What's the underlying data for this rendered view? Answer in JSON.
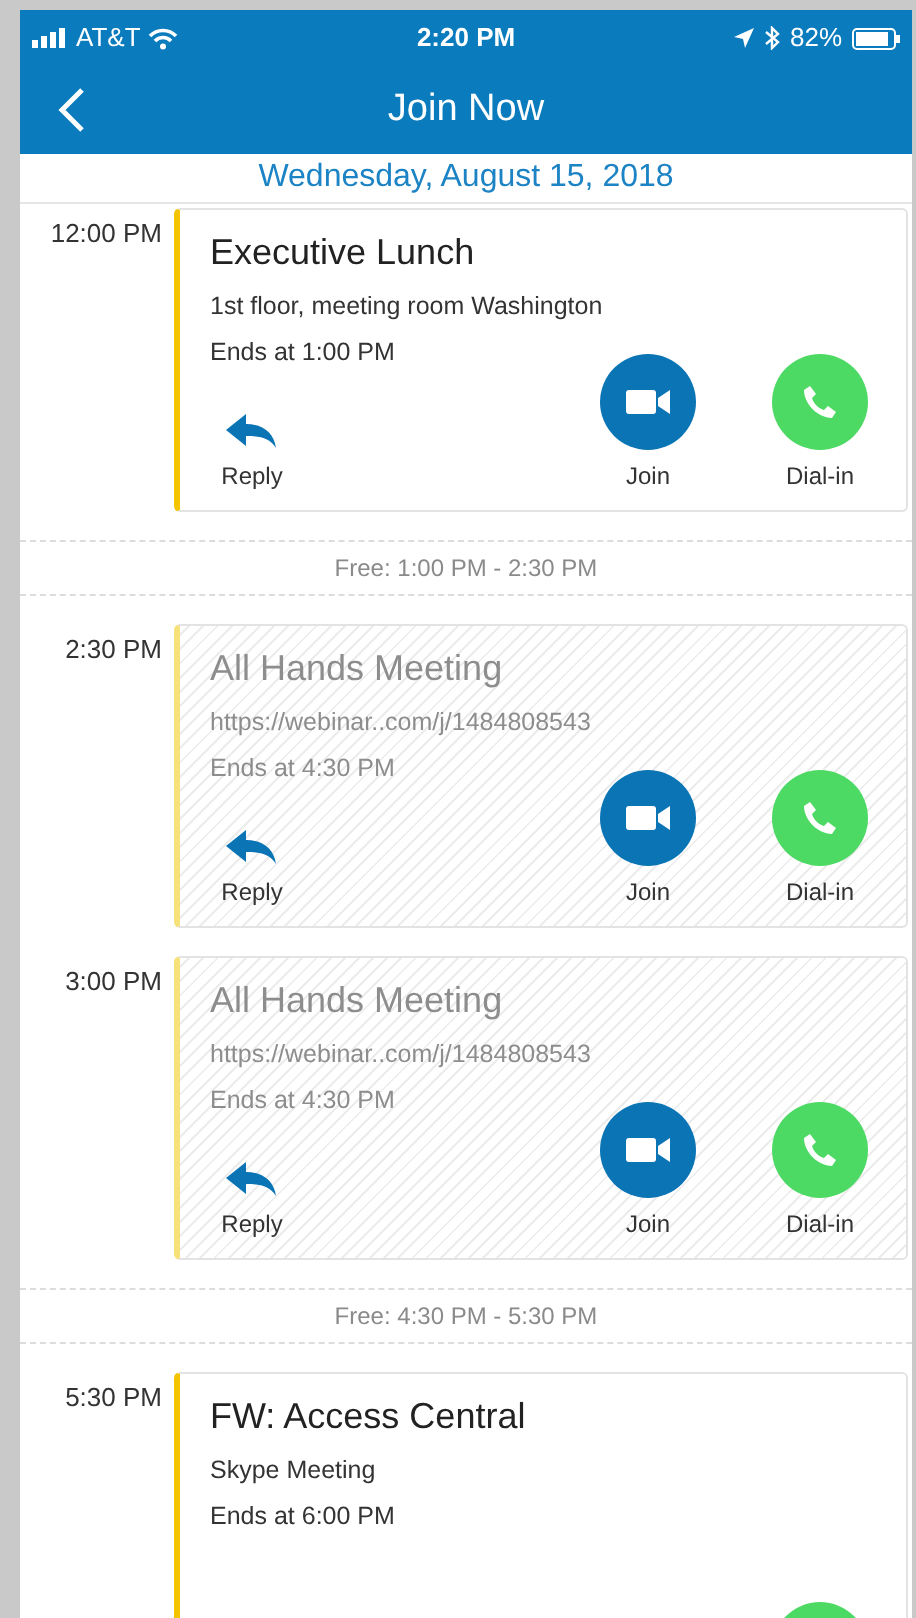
{
  "status_bar": {
    "carrier": "AT&T",
    "time": "2:20 PM",
    "battery": "82%"
  },
  "nav": {
    "title": "Join Now"
  },
  "date": "Wednesday, August 15, 2018",
  "agenda": [
    {
      "kind": "event",
      "time": "12:00 PM",
      "title": "Executive Lunch",
      "details": [
        "1st floor, meeting room Washington",
        "Ends at 1:00 PM"
      ],
      "tentative": false,
      "actions": [
        {
          "kind": "reply",
          "label": "Reply"
        },
        {
          "kind": "join",
          "label": "Join"
        },
        {
          "kind": "dial",
          "label": "Dial-in"
        }
      ]
    },
    {
      "kind": "free",
      "label": "Free: 1:00 PM - 2:30 PM"
    },
    {
      "kind": "event",
      "time": "2:30 PM",
      "title": "All Hands Meeting",
      "details": [
        "https://webinar..com/j/1484808543",
        "Ends at 4:30 PM"
      ],
      "tentative": true,
      "actions": [
        {
          "kind": "reply",
          "label": "Reply"
        },
        {
          "kind": "join",
          "label": "Join"
        },
        {
          "kind": "dial",
          "label": "Dial-in"
        }
      ]
    },
    {
      "kind": "event",
      "time": "3:00 PM",
      "title": "All Hands Meeting",
      "details": [
        "https://webinar..com/j/1484808543",
        "Ends at 4:30 PM"
      ],
      "tentative": true,
      "actions": [
        {
          "kind": "reply",
          "label": "Reply"
        },
        {
          "kind": "join",
          "label": "Join"
        },
        {
          "kind": "dial",
          "label": "Dial-in"
        }
      ]
    },
    {
      "kind": "free",
      "label": "Free: 4:30 PM - 5:30 PM"
    },
    {
      "kind": "event",
      "time": "5:30 PM",
      "title": "FW: Access Central",
      "details": [
        "Skype Meeting",
        "Ends at 6:00 PM"
      ],
      "tentative": false,
      "actions": [
        {
          "kind": "dial"
        }
      ]
    }
  ]
}
